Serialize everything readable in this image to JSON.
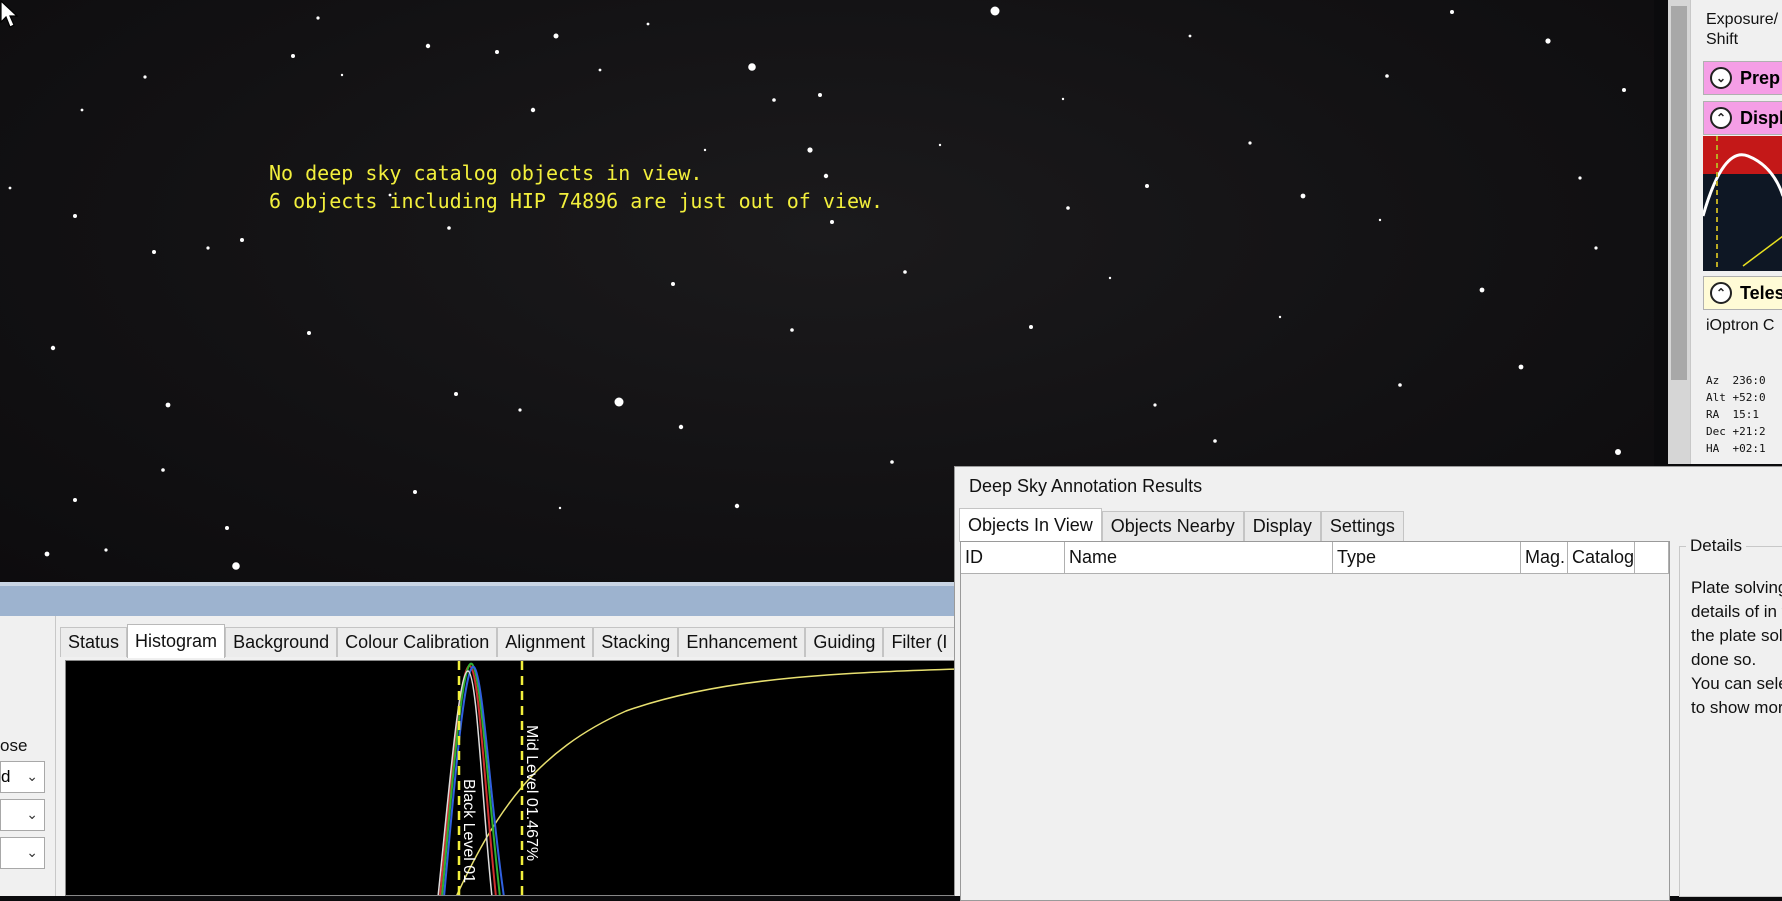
{
  "sky": {
    "line1": "No deep sky catalog objects in view.",
    "line2": "6 objects including HIP 74896 are just out of view."
  },
  "right_panel": {
    "exposure_label_1": "Exposure/",
    "exposure_label_2": "Shift",
    "section_prep": "Prep",
    "section_prep_color": "#f59ee6",
    "section_display": "Displ",
    "section_display_color": "#f59ee6",
    "section_telescope": "Teles",
    "section_telescope_color": "#fffbd6",
    "telescope_name": "iOptron C",
    "coords": [
      {
        "label": "Az",
        "value": "236:0"
      },
      {
        "label": "Alt",
        "value": "+52:0"
      },
      {
        "label": "RA",
        "value": "15:1"
      },
      {
        "label": "Dec",
        "value": "+21:2"
      },
      {
        "label": "HA",
        "value": "+02:1"
      }
    ]
  },
  "left_controls": {
    "label": "ose",
    "combo1": "d"
  },
  "tabs": [
    "Status",
    "Histogram",
    "Background",
    "Colour Calibration",
    "Alignment",
    "Stacking",
    "Enhancement",
    "Guiding",
    "Filter (I"
  ],
  "active_tab": "Histogram",
  "histogram": {
    "black_level_label": "Black Level 01",
    "mid_level_label": "Mid Level 01.467%"
  },
  "dsa": {
    "title": "Deep Sky Annotation Results",
    "tabs": [
      "Objects In View",
      "Objects Nearby",
      "Display",
      "Settings"
    ],
    "active_tab": "Objects In View",
    "columns": [
      "ID",
      "Name",
      "Type",
      "Mag.",
      "Catalog"
    ],
    "details_title": "Details",
    "details_p1": "Plate solving\ndetails of in v\nthe plate solv\ndone so.",
    "details_p2": "You can selec\nto show mor"
  },
  "colors": {
    "annotation_text": "#f2ef3c",
    "accent_blue_bar": "#9db3cf"
  }
}
